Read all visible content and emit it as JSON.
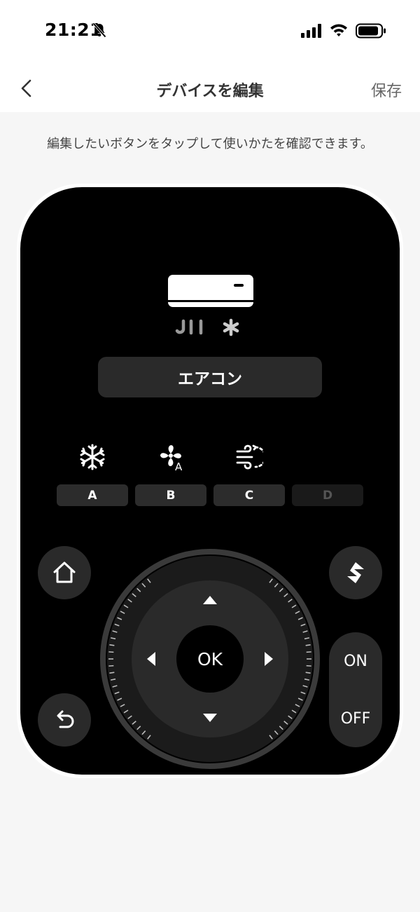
{
  "status_bar": {
    "time": "21:21",
    "icons": [
      "bell-slash-icon",
      "cellular-signal-icon",
      "wifi-icon",
      "battery-icon"
    ]
  },
  "nav": {
    "back_icon": "chevron-left-icon",
    "title": "デバイスを編集",
    "save_label": "保存"
  },
  "instruction": "編集したいボタンをタップして使いかたを確認できます。",
  "remote": {
    "device_icon": "air-conditioner-icon",
    "device_name": "エアコン",
    "mode_icons": [
      "snowflake-icon",
      "fan-auto-icon",
      "wind-swing-icon"
    ],
    "mode_buttons": [
      "A",
      "B",
      "C",
      "D"
    ],
    "disabled_mode": "D",
    "home_icon": "home-icon",
    "back_icon": "return-arrow-icon",
    "switch_icon": "switch-input-icon",
    "dpad": {
      "ok_label": "OK",
      "arrows": [
        "up-arrow-icon",
        "down-arrow-icon",
        "left-arrow-icon",
        "right-arrow-icon"
      ]
    },
    "on_label": "ON",
    "off_label": "OFF"
  },
  "colors": {
    "remote_body": "#000000",
    "button_bg": "#2a2a2a",
    "screen_bg": "#f6f6f6",
    "header_bg": "#ffffff"
  }
}
